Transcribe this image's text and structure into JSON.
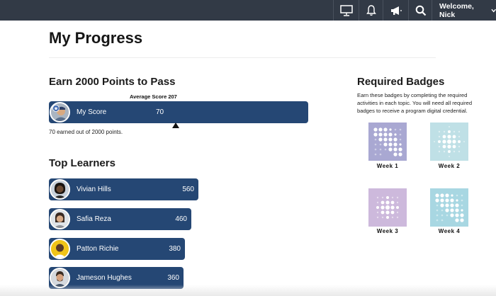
{
  "header": {
    "icons": [
      "presentation-icon",
      "bell-icon",
      "megaphone-icon",
      "search-icon"
    ],
    "welcome": "Welcome, Nick"
  },
  "page": {
    "title": "My Progress"
  },
  "progress": {
    "section_title": "Earn 2000 Points to Pass",
    "average_label": "Average Score 207",
    "my_score_label": "My Score",
    "my_score_value": "70",
    "earned_text": "70 earned out of 2000 points."
  },
  "top_learners": {
    "section_title": "Top Learners",
    "items": [
      {
        "name": "Vivian Hills",
        "score": "560"
      },
      {
        "name": "Safia Reza",
        "score": "460"
      },
      {
        "name": "Patton Richie",
        "score": "380"
      },
      {
        "name": "Jameson Hughes",
        "score": "360"
      }
    ]
  },
  "badges": {
    "section_title": "Required Badges",
    "intro": "Earn these badges by completing the required activities in each topic. You will need all required badges to receive a program digital credential.",
    "items": [
      {
        "label": "Week 1",
        "color": "#a9a8d2"
      },
      {
        "label": "Week 2",
        "color": "#bfe0e6"
      },
      {
        "label": "Week 3",
        "color": "#cdb9dc"
      },
      {
        "label": "Week 4",
        "color": "#a8d7e2"
      }
    ]
  },
  "colors": {
    "topbar": "#323a46",
    "bar": "#254774"
  }
}
